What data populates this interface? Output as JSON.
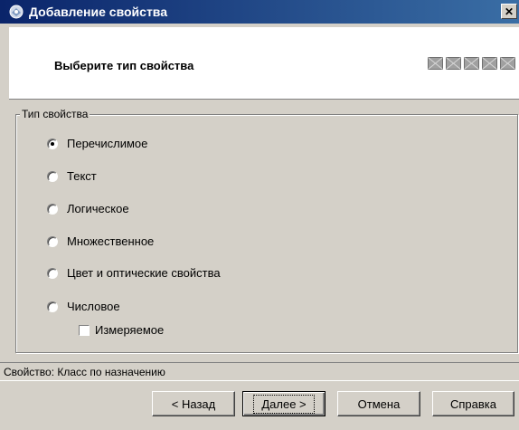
{
  "window": {
    "title": "Добавление свойства",
    "close_label": "✕"
  },
  "header": {
    "heading": "Выберите тип свойства",
    "step_icons": [
      "step-icon",
      "step-icon",
      "step-icon",
      "step-icon",
      "step-icon"
    ]
  },
  "group": {
    "legend": "Тип свойства",
    "options": [
      {
        "label": "Перечислимое",
        "checked": true
      },
      {
        "label": "Текст",
        "checked": false
      },
      {
        "label": "Логическое",
        "checked": false
      },
      {
        "label": "Множественное",
        "checked": false
      },
      {
        "label": "Цвет и оптические свойства",
        "checked": false
      },
      {
        "label": "Числовое",
        "checked": false
      }
    ],
    "measurable_label": "Измеряемое",
    "measurable_checked": false
  },
  "status": {
    "text": "Свойство: Класс по назначению"
  },
  "buttons": {
    "back": "< Назад",
    "next": "Далее >",
    "cancel": "Отмена",
    "help": "Справка"
  }
}
